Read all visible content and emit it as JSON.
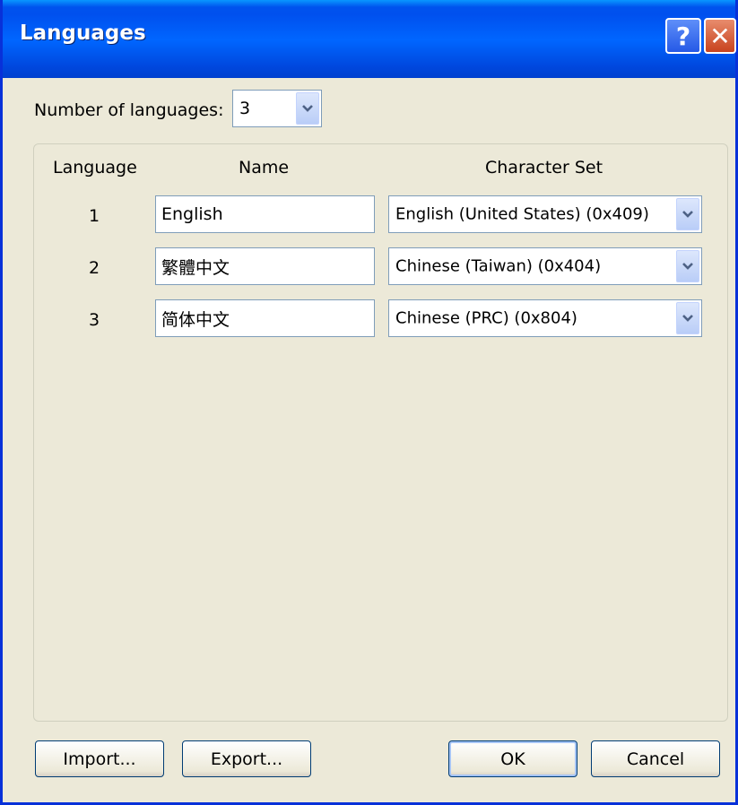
{
  "window": {
    "title": "Languages",
    "help_glyph": "?",
    "close_glyph": "✕"
  },
  "count": {
    "label": "Number of languages:",
    "value": "3"
  },
  "table": {
    "headers": [
      "Language",
      "Name",
      "Character Set"
    ],
    "rows": [
      {
        "num": "1",
        "name": "English",
        "charset": "English (United States) (0x409)"
      },
      {
        "num": "2",
        "name": "繁體中文",
        "charset": "Chinese (Taiwan) (0x404)"
      },
      {
        "num": "3",
        "name": "简体中文",
        "charset": "Chinese (PRC) (0x804)"
      }
    ]
  },
  "buttons": {
    "import": "Import...",
    "export": "Export...",
    "ok": "OK",
    "cancel": "Cancel"
  },
  "icons": {
    "dropdown": "chevron-down-icon",
    "help": "help-icon",
    "close": "close-icon"
  }
}
